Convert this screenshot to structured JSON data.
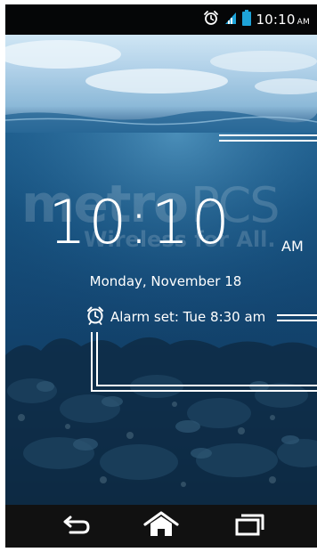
{
  "status_bar": {
    "time": "10:10",
    "ampm": "AM",
    "icons": [
      "alarm-icon",
      "signal-icon",
      "battery-icon"
    ]
  },
  "lockscreen": {
    "clock_time": "10:10",
    "clock_ampm": "AM",
    "date": "Monday, November 18",
    "alarm_label": "Alarm set: Tue 8:30 am"
  },
  "wallpaper": {
    "brand": "metro",
    "brand_suffix": "PCS",
    "tagline": "Wireless for All."
  },
  "nav_bar": {
    "buttons": [
      "back-icon",
      "home-icon",
      "recent-apps-icon"
    ]
  },
  "colors": {
    "status_bar": "#050607",
    "nav_bar": "#111111",
    "text": "#ffffff",
    "water": "#154f7c"
  }
}
